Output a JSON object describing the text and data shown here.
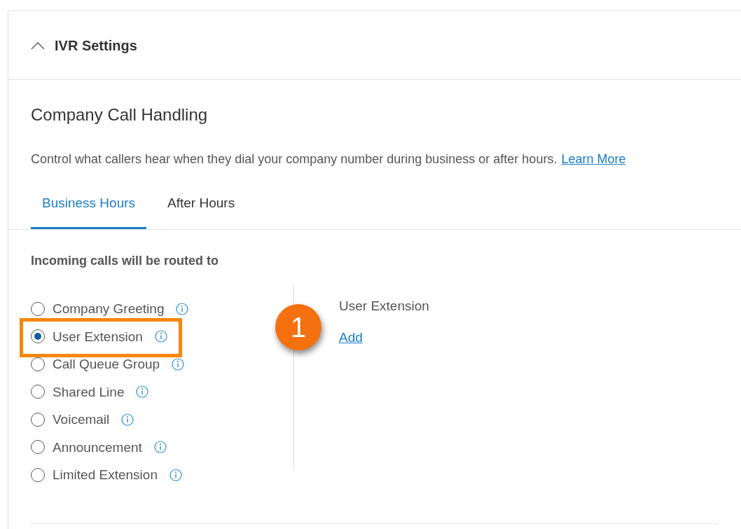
{
  "section": {
    "title": "IVR Settings",
    "expanded": true
  },
  "heading": "Company Call Handling",
  "description": "Control what callers hear when they dial your company number during business or after hours.",
  "learn_more": "Learn More",
  "tabs": [
    {
      "label": "Business Hours",
      "selected": true
    },
    {
      "label": "After Hours",
      "selected": false
    }
  ],
  "routing_label": "Incoming calls will be routed to",
  "options": [
    {
      "label": "Company Greeting",
      "selected": false,
      "highlighted": false
    },
    {
      "label": "User Extension",
      "selected": true,
      "highlighted": true
    },
    {
      "label": "Call Queue Group",
      "selected": false,
      "highlighted": false
    },
    {
      "label": "Shared Line",
      "selected": false,
      "highlighted": false
    },
    {
      "label": "Voicemail",
      "selected": false,
      "highlighted": false
    },
    {
      "label": "Announcement",
      "selected": false,
      "highlighted": false
    },
    {
      "label": "Limited Extension",
      "selected": false,
      "highlighted": false
    }
  ],
  "detail": {
    "title": "User Extension",
    "action": "Add"
  },
  "callout": "1"
}
